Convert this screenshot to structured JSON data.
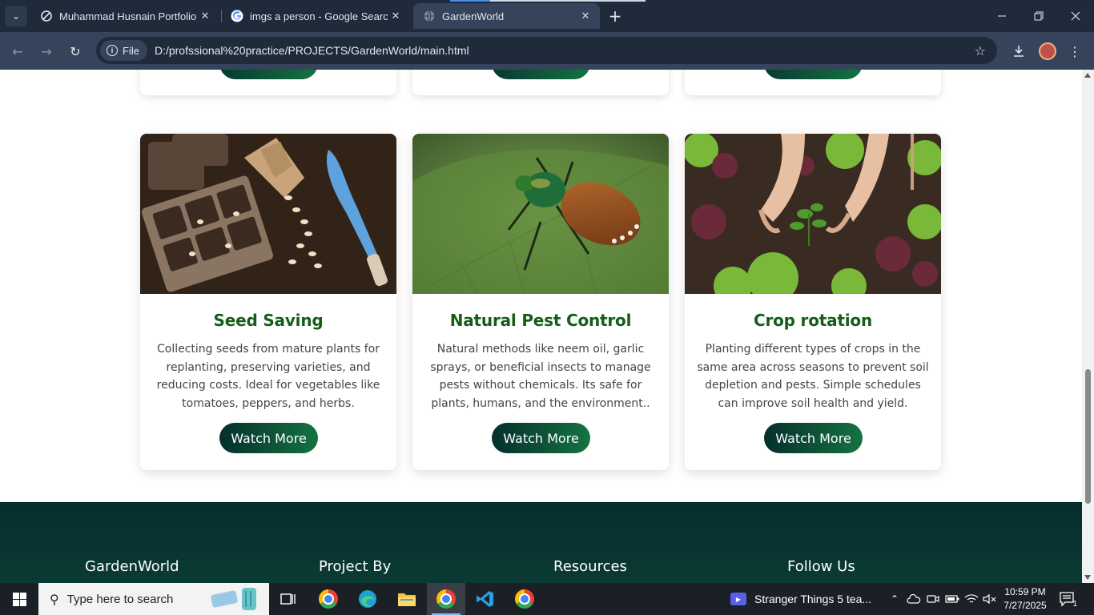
{
  "browser": {
    "tabs": [
      {
        "title": "Muhammad Husnain Portfolio D",
        "icon": "portfolio-favicon",
        "active": false
      },
      {
        "title": "imgs a person - Google Search",
        "icon": "google-favicon",
        "active": false
      },
      {
        "title": "GardenWorld",
        "icon": "globe-favicon",
        "active": true
      }
    ],
    "scheme_chip": "File",
    "url": "D:/profssional%20practice/PROJECTS/GardenWorld/main.html"
  },
  "cards": [
    {
      "title": "Seed Saving",
      "description": "Collecting seeds from mature plants for replanting, preserving varieties, and reducing costs. Ideal for vegetables like tomatoes, peppers, and herbs.",
      "button": "Watch More",
      "image": "seed-tray-photo"
    },
    {
      "title": "Natural Pest Control",
      "description": "Natural methods like neem oil, garlic sprays, or beneficial insects to manage pests without chemicals. Its safe for plants, humans, and the environment..",
      "button": "Watch More",
      "image": "beetle-on-leaf-photo"
    },
    {
      "title": "Crop rotation",
      "description": "Planting different types of crops in the same area across seasons to prevent soil depletion and pests. Simple schedules can improve soil health and yield.",
      "button": "Watch More",
      "image": "hands-planting-photo"
    }
  ],
  "footer": {
    "headings": [
      "GardenWorld",
      "Project By",
      "Resources",
      "Follow Us"
    ]
  },
  "taskbar": {
    "search_placeholder": "Type here to search",
    "media_title": "Stranger Things 5 tea...",
    "time": "10:59 PM",
    "date": "7/27/2025",
    "notification_count": "1"
  },
  "colors": {
    "card_title": "#155e18",
    "button_gradient_start": "#052f2c",
    "button_gradient_end": "#157342",
    "footer_bg": "#062e2c",
    "chrome_dark": "#1f2a3a",
    "chrome_toolbar": "#35445a"
  }
}
